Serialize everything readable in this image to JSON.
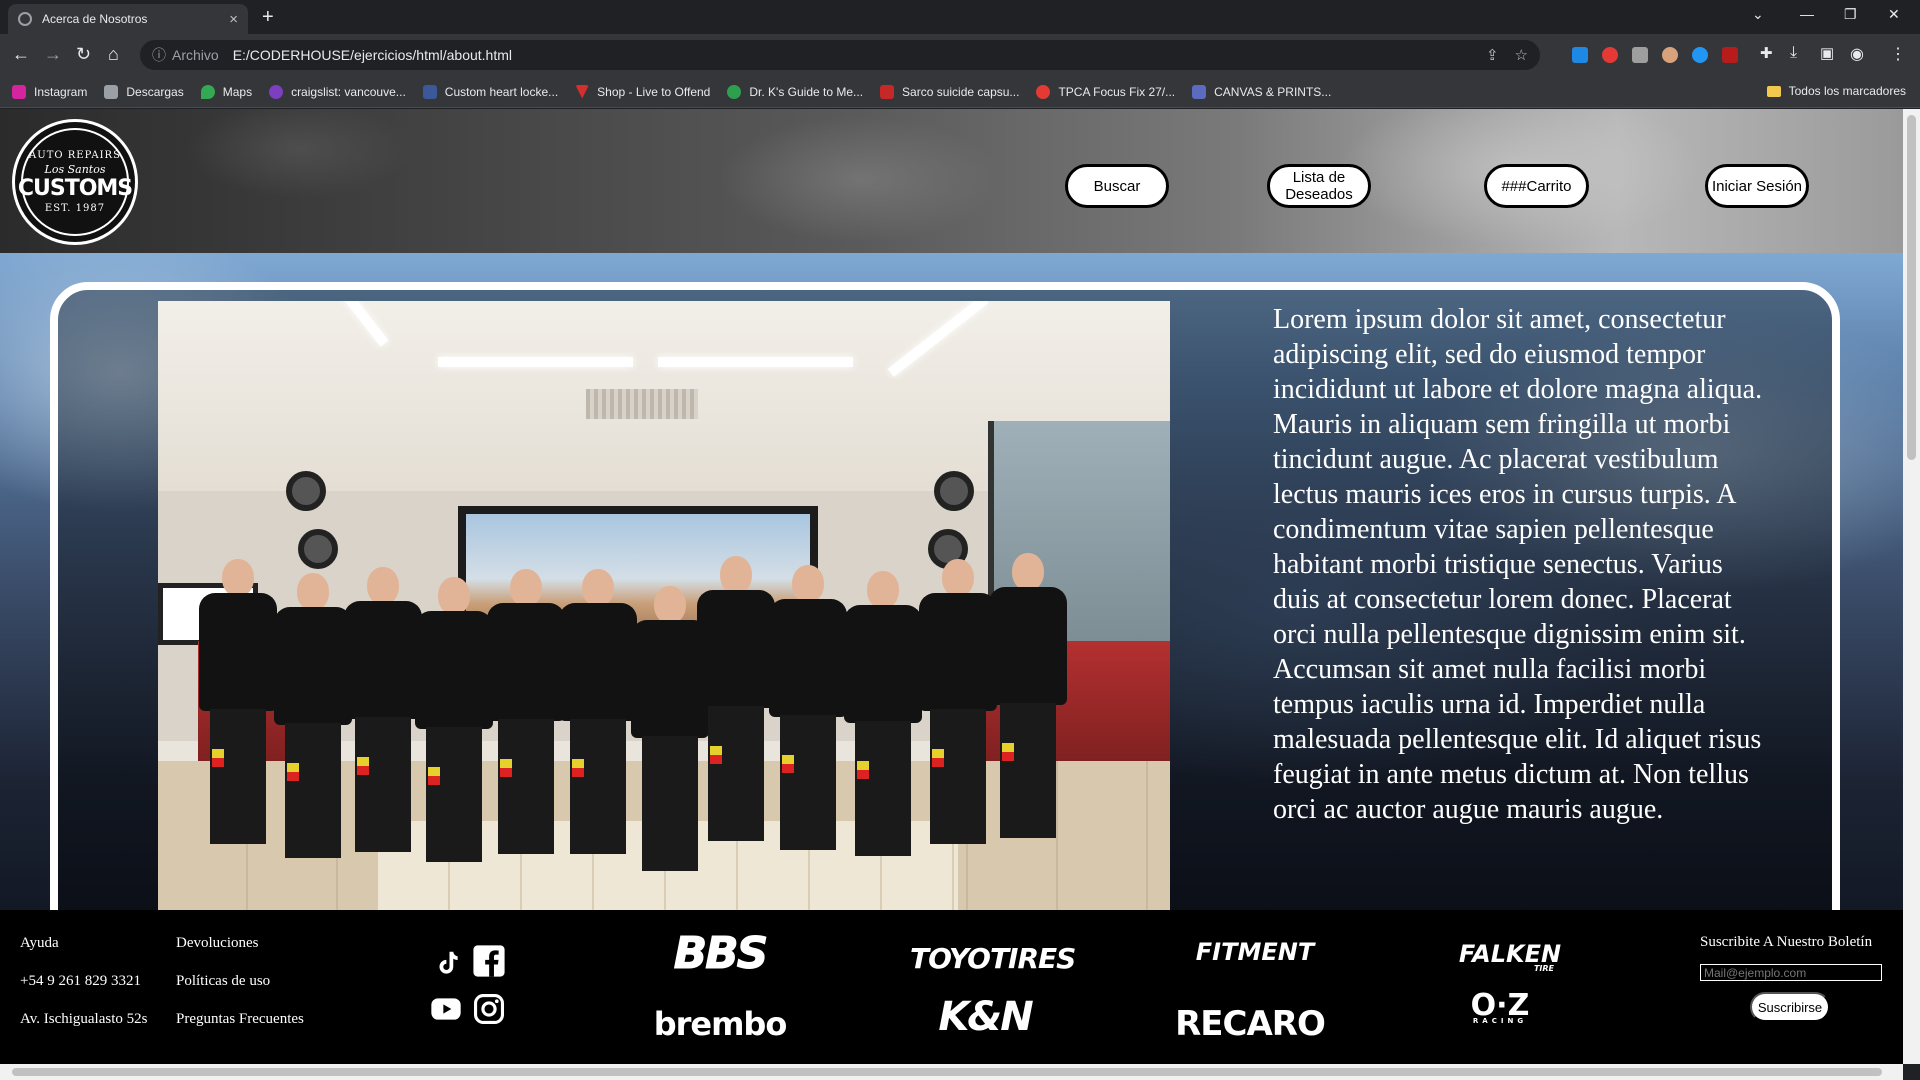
{
  "browser": {
    "tab_title": "Acerca de Nosotros",
    "tab_close": "×",
    "new_tab": "+",
    "address_scheme": "Archivo",
    "address_url": "E:/CODERHOUSE/ejercicios/html/about.html",
    "bookmarks": [
      {
        "label": "Instagram",
        "color": "#d6249f"
      },
      {
        "label": "Descargas",
        "color": "#9aa0a6"
      },
      {
        "label": "Maps",
        "color": "#34a853"
      },
      {
        "label": "craigslist: vancouve...",
        "color": "#7b3fbf"
      },
      {
        "label": "Custom heart locke...",
        "color": "#3b5998"
      },
      {
        "label": "Shop - Live to Offend",
        "color": "#d32f2f"
      },
      {
        "label": "Dr. K's Guide to Me...",
        "color": "#2e9e4f"
      },
      {
        "label": "Sarco suicide capsu...",
        "color": "#c62828"
      },
      {
        "label": "TPCA Focus Fix 27/...",
        "color": "#e53935"
      },
      {
        "label": "CANVAS & PRINTS...",
        "color": "#5c6bc0"
      }
    ],
    "all_bookmarks": "Todos los marcadores"
  },
  "header": {
    "logo": {
      "top": "AUTO REPAIRS",
      "script": "Los Santos",
      "main": "CUSTOMS",
      "est": "EST. 1987"
    },
    "buttons": {
      "search": "Buscar",
      "wishlist": "Lista de Deseados",
      "cart": "###Carrito",
      "login": "Iniciar Sesión"
    }
  },
  "about": {
    "text": "Lorem ipsum dolor sit amet, consectetur adipiscing elit, sed do eiusmod tempor incididunt ut labore et dolore magna aliqua. Mauris in aliquam sem fringilla ut morbi tincidunt augue. Ac placerat vestibulum lectus mauris ices eros in cursus turpis. A condimentum vitae sapien pellentesque habitant morbi tristique senectus. Varius duis at consectetur lorem donec. Placerat orci nulla pellentesque dignissim enim sit. Accumsan sit amet nulla facilisi morbi tempus iaculis urna id. Imperdiet nulla malesuada pellentesque elit. Id aliquet risus feugiat in ante metus dictum at. Non tellus orci ac auctor augue mauris augue."
  },
  "footer": {
    "col1": [
      "Ayuda",
      "+54 9 261 829 3321",
      "Av. Ischigualasto 52s"
    ],
    "col2": [
      "Devoluciones",
      "Políticas de uso",
      "Preguntas Frecuentes"
    ],
    "brands": [
      "BBS",
      "TOYOTIRES",
      "FITMENT",
      "FALKEN",
      "brembo",
      "K&N",
      "RECARO",
      "O·Z"
    ],
    "brand_sub": {
      "falken": "TIRE",
      "oz": "RACING"
    },
    "newsletter": {
      "title": "Suscribite A Nuestro Boletín",
      "placeholder": "Mail@ejemplo.com",
      "button": "Suscribirse"
    }
  }
}
